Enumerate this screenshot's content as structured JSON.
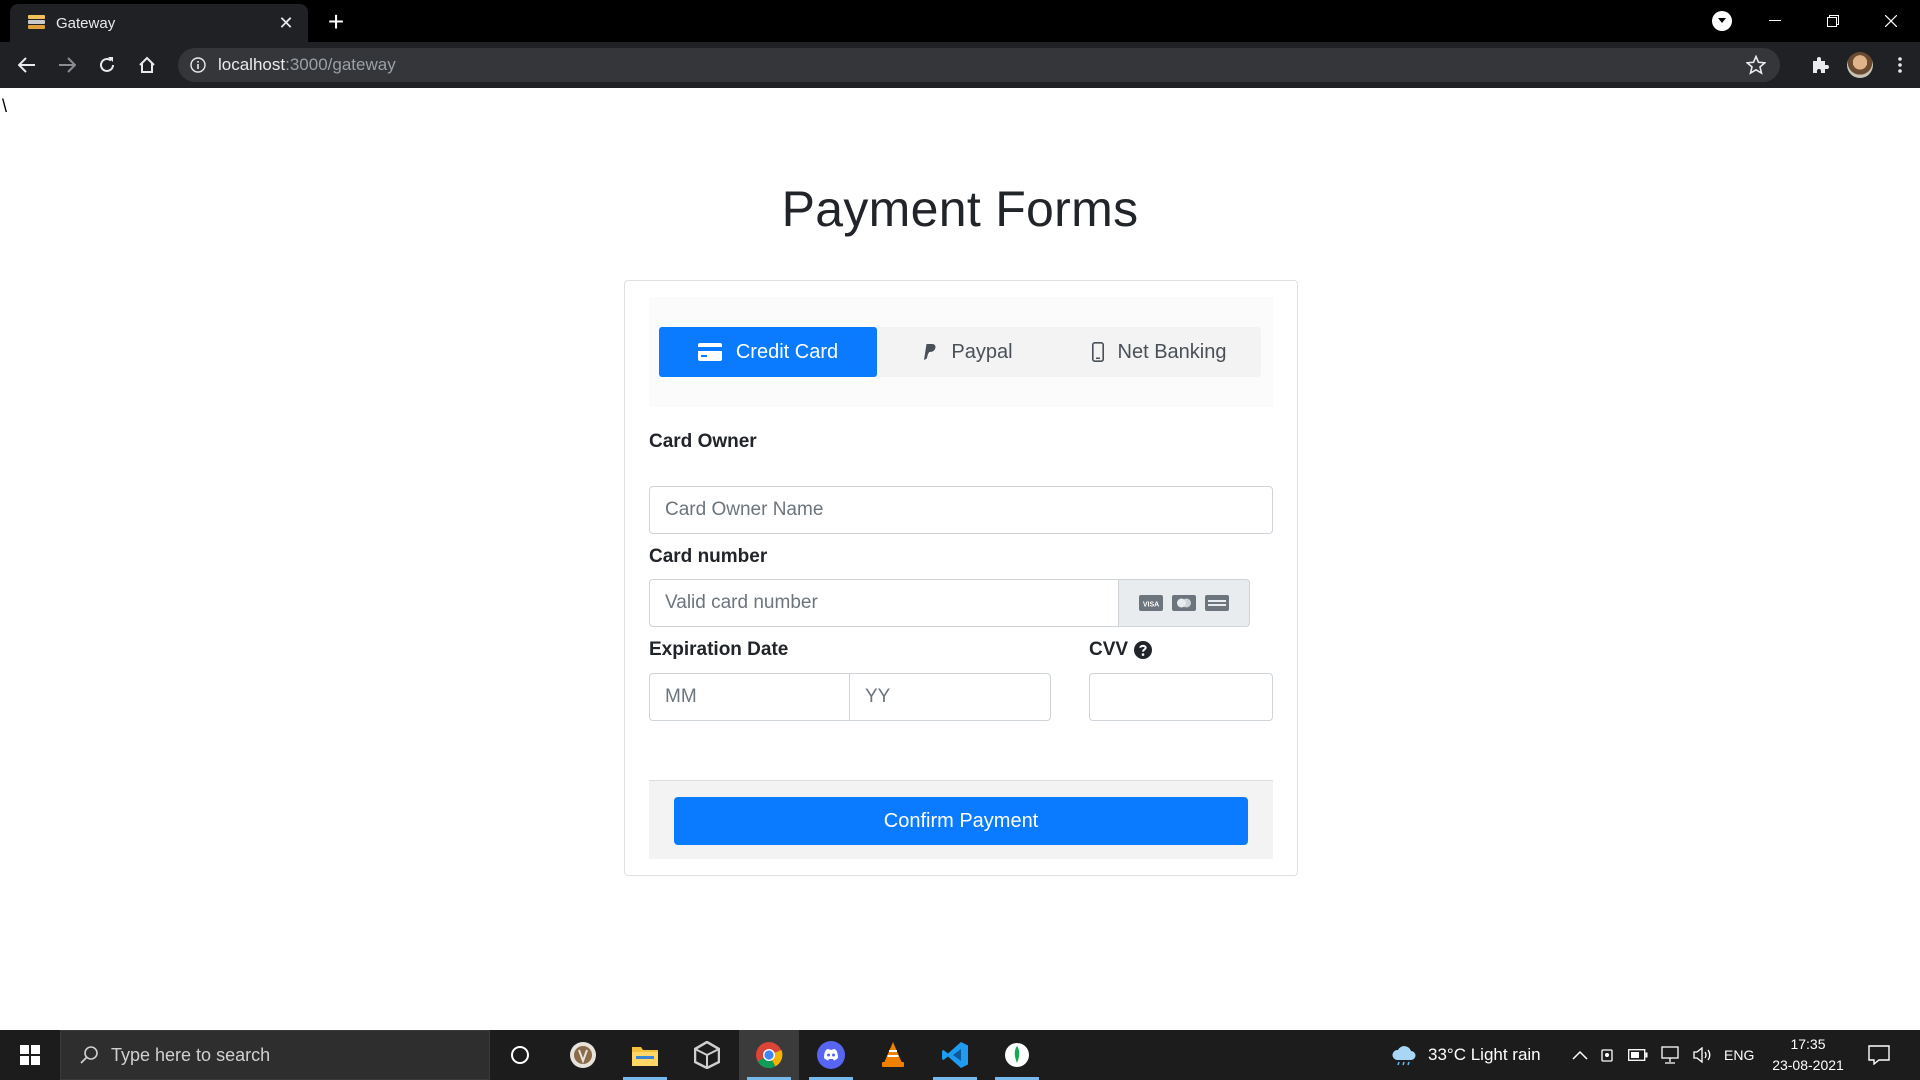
{
  "browser": {
    "tab_title": "Gateway",
    "url_host": "localhost",
    "url_path": ":3000/gateway"
  },
  "page": {
    "stray_char": "\\",
    "heading": "Payment Forms",
    "tabs": [
      {
        "label": "Credit Card",
        "icon": "credit-card-icon",
        "active": true
      },
      {
        "label": "Paypal",
        "icon": "paypal-icon",
        "active": false
      },
      {
        "label": "Net Banking",
        "icon": "mobile-icon",
        "active": false
      }
    ],
    "card_owner": {
      "label": "Card Owner",
      "placeholder": "Card Owner Name",
      "value": ""
    },
    "card_number": {
      "label": "Card number",
      "placeholder": "Valid card number",
      "value": "",
      "brand_icons": [
        "visa-icon",
        "mastercard-icon",
        "amex-icon"
      ]
    },
    "expiration": {
      "label": "Expiration Date",
      "month_placeholder": "MM",
      "year_placeholder": "YY"
    },
    "cvv": {
      "label": "CVV",
      "value": ""
    },
    "confirm_label": "Confirm Payment"
  },
  "taskbar": {
    "search_placeholder": "Type here to search",
    "apps": [
      "cortana-icon",
      "app-icon",
      "file-explorer-icon",
      "unity-icon",
      "chrome-icon",
      "discord-icon",
      "vlc-icon",
      "vscode-icon",
      "mongodb-compass-icon"
    ],
    "weather": "33°C  Light rain",
    "language": "ENG",
    "time": "17:35",
    "date": "23-08-2021"
  },
  "colors": {
    "primary": "#0a7bff",
    "chrome_dark": "#202124"
  }
}
